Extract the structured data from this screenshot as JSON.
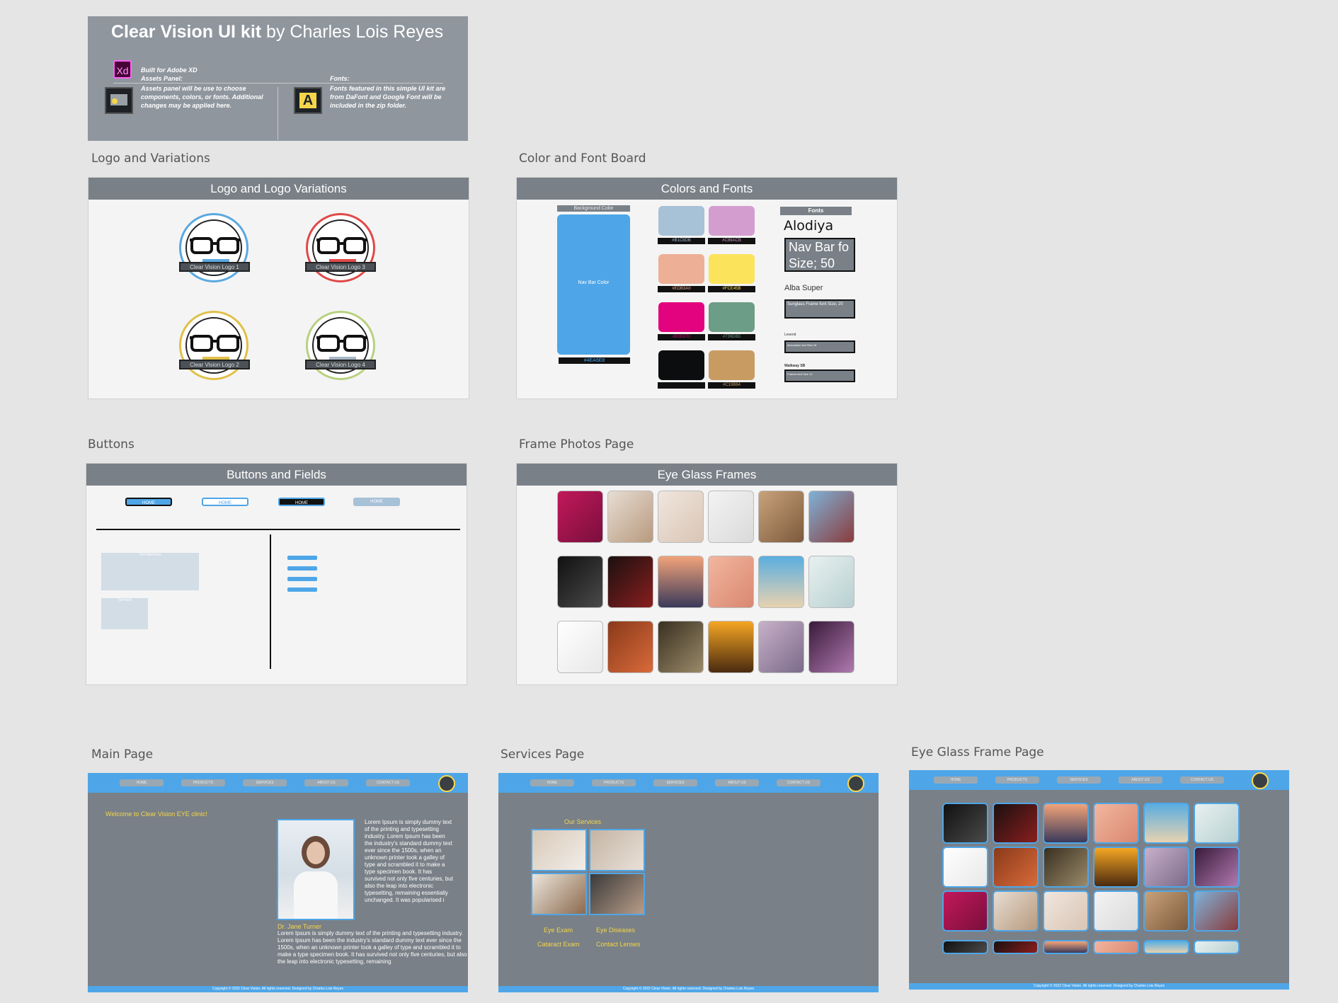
{
  "title_card": {
    "title_bold": "Clear Vision UI kit",
    "title_rest": " by Charles Lois Reyes",
    "xd_icon_text": "Xd",
    "built_for": "Built for Adobe XD",
    "assets_heading": "Assets Panel:",
    "assets_text": "Assets panel will be use to choose components, colors, or fonts. Additional changes may be applied here.",
    "fonts_heading": "Fonts:",
    "fonts_text": "Fonts featured in this simple UI kit are from DaFont and Google Font will be included in the zip folder.",
    "fonts_icon_letter": "A"
  },
  "labels": {
    "logo": "Logo and Variations",
    "color": "Color and Font Board",
    "buttons": "Buttons",
    "frames": "Frame Photos Page",
    "main": "Main Page",
    "services": "Services Page",
    "eyeglass": "Eye Glass Frame Page"
  },
  "logo_board": {
    "header": "Logo and Logo Variations",
    "logos": [
      {
        "caption": "Clear Vision Logo 1",
        "ring": "#5aa8e0",
        "bar": "#5aa8e0"
      },
      {
        "caption": "Clear Vision Logo 3",
        "ring": "#e04848",
        "bar": "#e04848"
      },
      {
        "caption": "Clear Vision Logo 2",
        "ring": "#e0c048",
        "bar": "#e0c048"
      },
      {
        "caption": "Clear Vision Logo 4",
        "ring": "#b8d080",
        "bar": "#a8b8c8"
      }
    ]
  },
  "color_board": {
    "header": "Colors and Fonts",
    "bg_label": "Background Color",
    "nav_label": "Nav Bar Color",
    "nav_hex": "#4EA6E8",
    "swatches": [
      {
        "color": "#A7C1D7",
        "hex": "#B1C8DB"
      },
      {
        "color": "#D49DD0",
        "hex": "#C89ACB"
      },
      {
        "color": "#EDAF96",
        "hex": "#EDB3A0"
      },
      {
        "color": "#FCE35C",
        "hex": "#FCE45B"
      },
      {
        "color": "#E3037F",
        "hex": "#E0037D"
      },
      {
        "color": "#6C9D87",
        "hex": "#739D8D"
      },
      {
        "color": "#0C0D0E",
        "hex": "#0D1011"
      },
      {
        "color": "#C89B63",
        "hex": "#C19B64"
      }
    ],
    "fonts_label": "Fonts",
    "font1": "Alodiya",
    "font1_box": "Nav Bar fo Size; 50",
    "font2": "Alba Super",
    "font2_box": "Sunglass Frame font Size; 20",
    "font3": "Lexend",
    "font3_box": "description text Size 16",
    "font4": "Walkway SB",
    "font4_box": "Frames text Size 12"
  },
  "button_board": {
    "header": "Buttons and Fields",
    "btn1": "HOME",
    "btn2": "HOME",
    "btn3": "HOME",
    "btn4": "HOME",
    "field1": "Text field here",
    "field2": "Text field"
  },
  "frames_board": {
    "header": "Eye Glass Frames"
  },
  "main_page": {
    "nav": [
      "HOME",
      "PRODUCTS",
      "SERVICES",
      "ABOUT US",
      "CONTACT US"
    ],
    "welcome": "Welcome  to Clear Vision EYE clinic!",
    "para1": "Lorem Ipsum is simply dummy text of the printing and typesetting industry. Lorem Ipsum has been the industry's standard dummy text ever since the 1500s, when an unknown printer took a galley of type and scrambled it to make a type specimen book. It has survived not only five centuries, but also the leap into electronic typesetting, remaining essentially unchanged. It was popularised i",
    "doctor": "Dr. Jane Turner",
    "para2": "Lorem Ipsum is simply dummy text of the printing and typesetting industry. Lorem Ipsum has been the industry's standard dummy text ever since the 1500s, when an unknown printer took a galley of type and scrambled it to make a type specimen book. It has survived not only five centuries, but also the leap into electronic typesetting, remaining",
    "footer": "Copyright © 2022 Clear Vision. All rights reserved. Designed by Charles Lois Reyes"
  },
  "services_page": {
    "nav": [
      "HOME",
      "PRODUCTS",
      "SERVICES",
      "ABOUT US",
      "CONTACT US"
    ],
    "heading": "Our Services",
    "s1": "Eye Exam",
    "s2": "Eye Diseases",
    "s3": "Cataract Exam",
    "s4": "Contact Lenses",
    "footer": "Copyright © 2022 Clear Vision. All rights reserved. Designed by Charles Lois Reyes"
  },
  "eyeglass_page": {
    "nav": [
      "HOME",
      "PRODUCTS",
      "SERVICES",
      "ABOUT US",
      "CONTACT US"
    ],
    "footer": "Copyright © 2022 Clear Vision. All rights reserved. Designed by Charles Lois Reyes"
  }
}
